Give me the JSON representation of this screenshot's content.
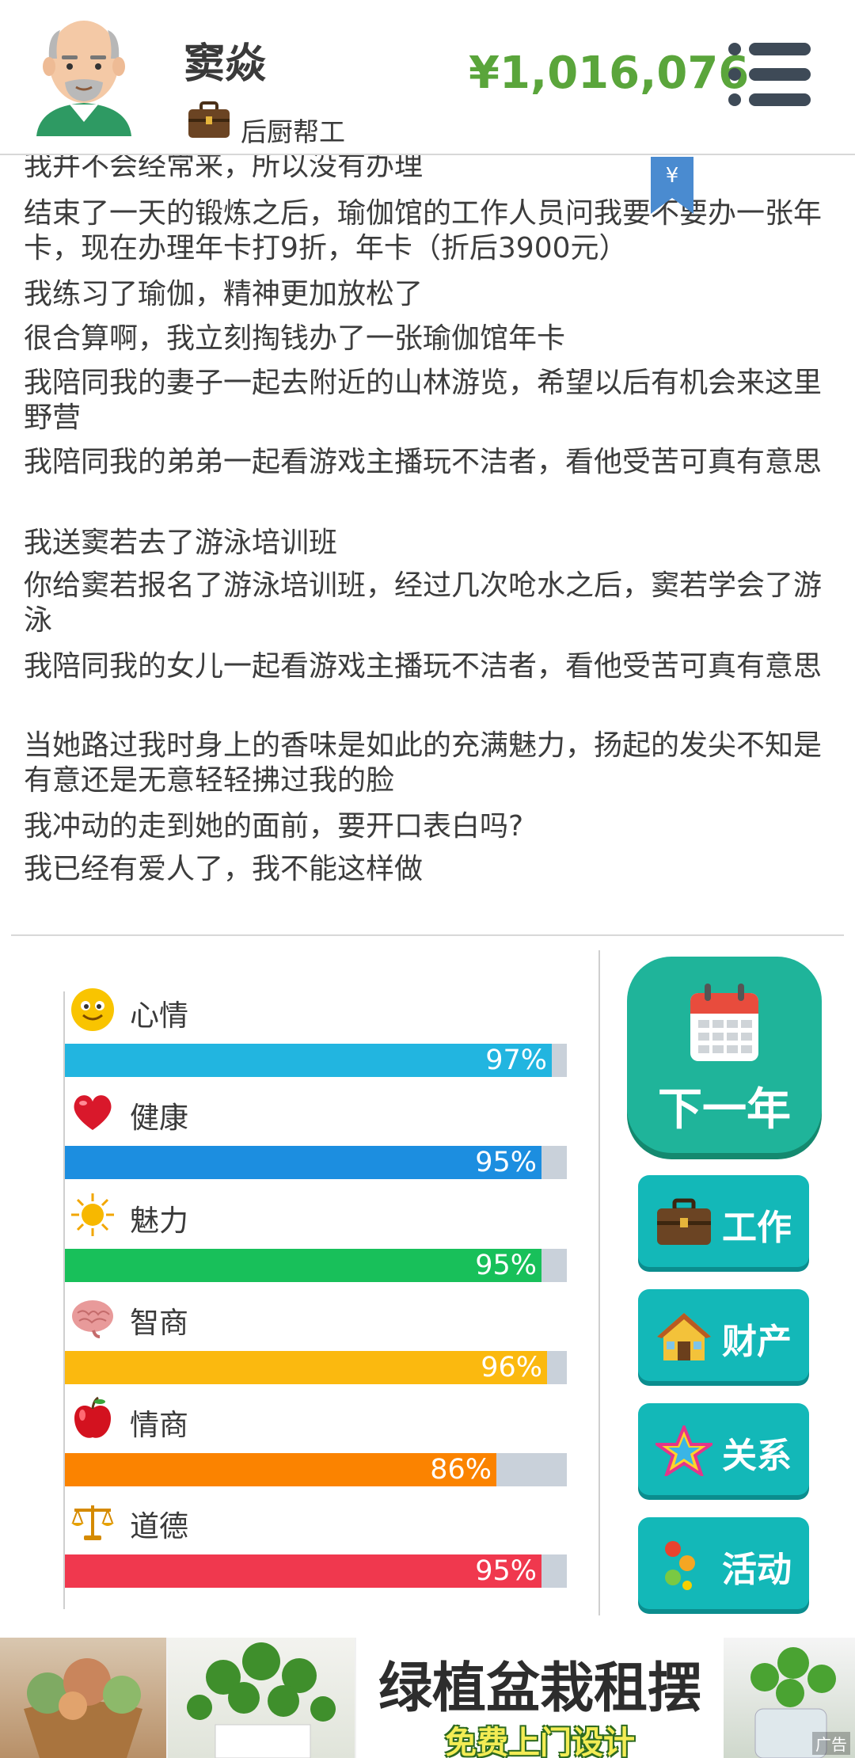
{
  "header": {
    "name": "窦焱",
    "job": "后厨帮工",
    "money": "¥1,016,076"
  },
  "log": {
    "lines": [
      "我并不会经常来，所以没有办理",
      "结束了一天的锻炼之后，瑜伽馆的工作人员问我要不要办一张年卡，现在办理年卡打9折，年卡（折后3900元）",
      "我练习了瑜伽，精神更加放松了",
      "很合算啊，我立刻掏钱办了一张瑜伽馆年卡",
      "我陪同我的妻子一起去附近的山林游览，希望以后有机会来这里野营",
      "我陪同我的弟弟一起看游戏主播玩不洁者，看他受苦可真有意思",
      "我送窦若去了游泳培训班",
      "你给窦若报名了游泳培训班，经过几次呛水之后，窦若学会了游泳",
      "我陪同我的女儿一起看游戏主播玩不洁者，看他受苦可真有意思",
      "当她路过我时身上的香味是如此的充满魅力，扬起的发尖不知是有意还是无意轻轻拂过我的脸",
      "我冲动的走到她的面前，要开口表白吗?",
      "我已经有爱人了，我不能这样做"
    ],
    "bookmark_symbol": "¥"
  },
  "stats": [
    {
      "label": "心情",
      "value": 97,
      "text": "97%",
      "color": "#22b5e0",
      "icon": "smiley-icon"
    },
    {
      "label": "健康",
      "value": 95,
      "text": "95%",
      "color": "#1c8ee0",
      "icon": "heart-icon"
    },
    {
      "label": "魅力",
      "value": 95,
      "text": "95%",
      "color": "#18c05a",
      "icon": "sun-icon"
    },
    {
      "label": "智商",
      "value": 96,
      "text": "96%",
      "color": "#fbb90f",
      "icon": "brain-icon"
    },
    {
      "label": "情商",
      "value": 86,
      "text": "86%",
      "color": "#fb8300",
      "icon": "apple-icon"
    },
    {
      "label": "道德",
      "value": 95,
      "text": "95%",
      "color": "#f0384e",
      "icon": "scales-icon"
    }
  ],
  "actions": {
    "next_year": "下一年",
    "work": "工作",
    "property": "财产",
    "relations": "关系",
    "activity": "活动"
  },
  "ad": {
    "title": "绿植盆栽租摆",
    "subtitle": "免费上门设计",
    "tag": "广告"
  }
}
